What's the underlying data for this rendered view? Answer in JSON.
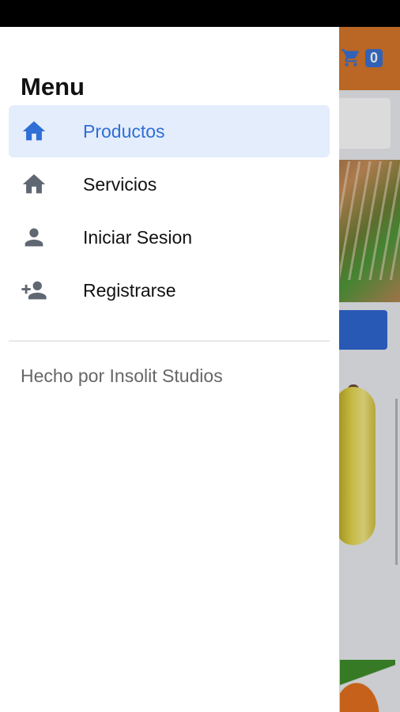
{
  "drawer": {
    "title": "Menu",
    "items": [
      {
        "label": "Productos",
        "icon": "home-icon",
        "active": true
      },
      {
        "label": "Servicios",
        "icon": "home-icon",
        "active": false
      },
      {
        "label": "Iniciar Sesion",
        "icon": "person-icon",
        "active": false
      },
      {
        "label": "Registrarse",
        "icon": "person-add-icon",
        "active": false
      }
    ],
    "footer": "Hecho por Insolit Studios"
  },
  "background_app": {
    "cart_count": "0",
    "cart_icon": "cart-icon"
  },
  "colors": {
    "accent": "#2f6fd6",
    "active_bg": "#e4edfc",
    "header": "#d9772a",
    "icon_gray": "#5f6772"
  }
}
